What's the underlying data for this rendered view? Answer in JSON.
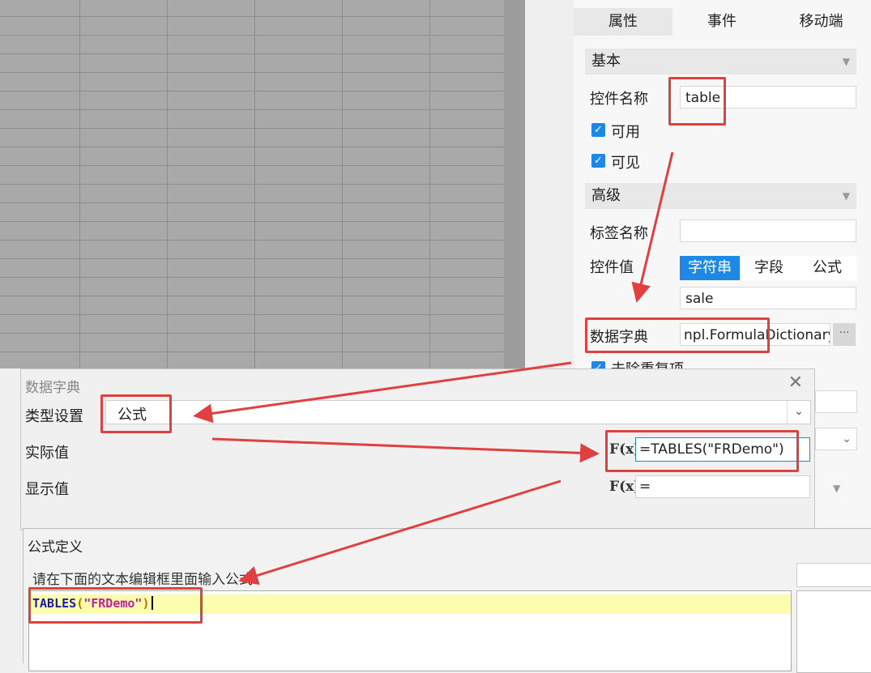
{
  "panel": {
    "tabs": [
      "属性",
      "事件",
      "移动端"
    ],
    "basic_section": "基本",
    "widget_name_label": "控件名称",
    "widget_name_value": "table",
    "enabled_label": "可用",
    "visible_label": "可见",
    "advanced_section": "高级",
    "tag_name_label": "标签名称",
    "tag_name_value": "",
    "widget_value_label": "控件值",
    "value_types": [
      "字符串",
      "字段",
      "公式"
    ],
    "widget_value": "sale",
    "data_dict_label": "数据字典",
    "data_dict_value": "npl.FormulaDictionary",
    "more_button": "···",
    "dedup_label": "去除重复项"
  },
  "dialog_dict": {
    "title": "数据字典",
    "type_label": "类型设置",
    "type_value": "公式",
    "actual_label": "实际值",
    "actual_value": "=TABLES(\"FRDemo\")",
    "display_label": "显示值",
    "display_value": "=",
    "fx_label": "F(x)"
  },
  "dialog_formula": {
    "title": "公式定义",
    "hint": "请在下面的文本编辑框里面输入公式.",
    "code_fn": "TABLES",
    "code_paren_open": "(",
    "code_string": "\"FRDemo\"",
    "code_paren_close": ")"
  },
  "colors": {
    "accent": "#1e88e5",
    "highlight": "#e04040",
    "editor_line": "#fdfdb0"
  }
}
